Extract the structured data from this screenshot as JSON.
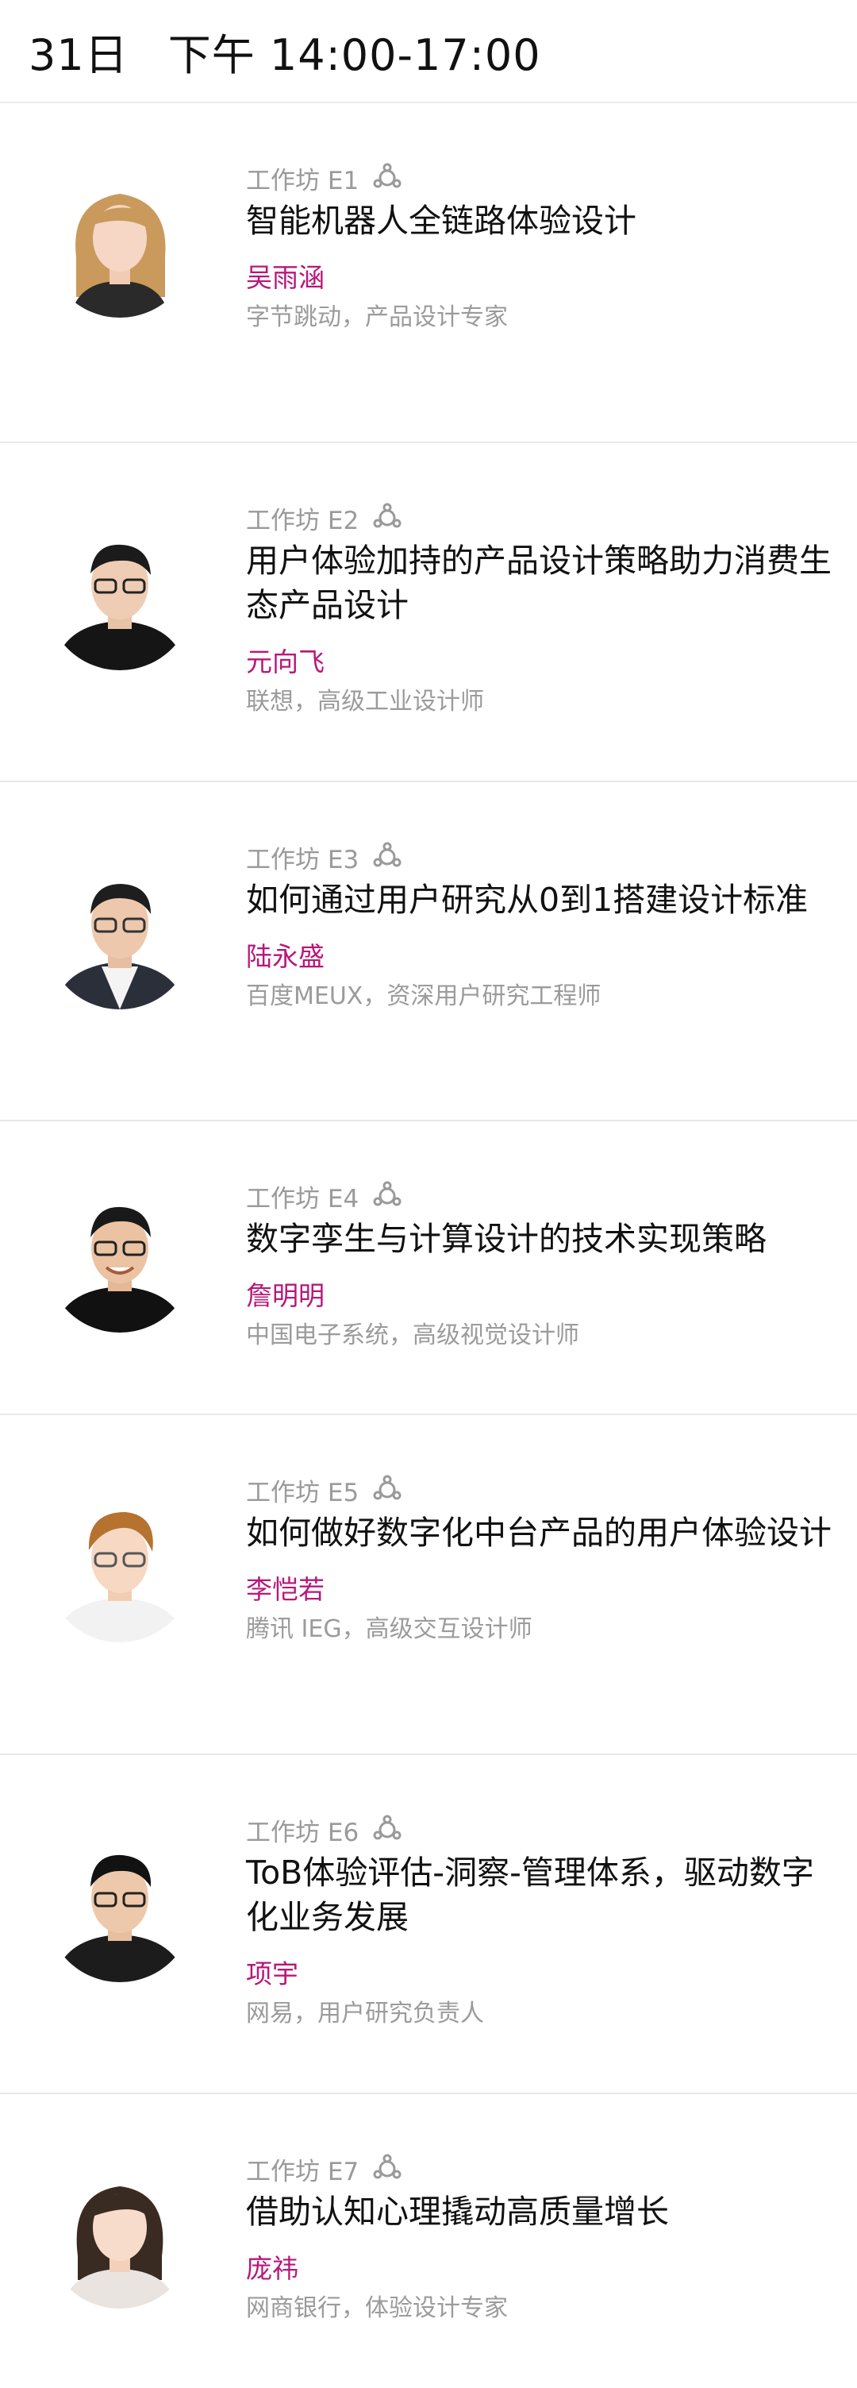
{
  "header": {
    "day": "31日",
    "time": "下午 14:00-17:00"
  },
  "sessions": [
    {
      "tag": "工作坊 E1",
      "title": "智能机器人全链路体验设计",
      "speaker": "吴雨涵",
      "org": "字节跳动，产品设计专家"
    },
    {
      "tag": "工作坊 E2",
      "title": "用户体验加持的产品设计策略助力消费生态产品设计",
      "speaker": "元向飞",
      "org": "联想，高级工业设计师"
    },
    {
      "tag": "工作坊 E3",
      "title": "如何通过用户研究从0到1搭建设计标准",
      "speaker": "陆永盛",
      "org": "百度MEUX，资深用户研究工程师"
    },
    {
      "tag": "工作坊 E4",
      "title": "数字孪生与计算设计的技术实现策略",
      "speaker": "詹明明",
      "org": "中国电子系统，高级视觉设计师"
    },
    {
      "tag": "工作坊 E5",
      "title": "如何做好数字化中台产品的用户体验设计",
      "speaker": "李恺若",
      "org": "腾讯 IEG，高级交互设计师"
    },
    {
      "tag": "工作坊 E6",
      "title": "ToB体验评估-洞察-管理体系，驱动数字化业务发展",
      "speaker": "项宇",
      "org": "网易，用户研究负责人"
    },
    {
      "tag": "工作坊 E7",
      "title": "借助认知心理撬动高质量增长",
      "speaker": "庞祎",
      "org": "网商银行，体验设计专家"
    }
  ],
  "colors": {
    "speaker": "#b8177a",
    "tag": "#9a9a9a",
    "divider": "#e8e8e8"
  },
  "icons": {
    "workshop": "workshop-icon",
    "avatar": "avatar"
  }
}
